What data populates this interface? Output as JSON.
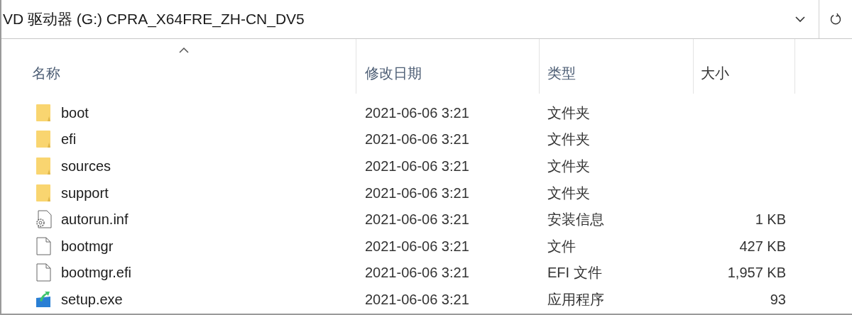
{
  "address_bar": {
    "path": "VD 驱动器 (G:) CPRA_X64FRE_ZH-CN_DV5"
  },
  "columns": [
    {
      "label": "名称",
      "sorted": true
    },
    {
      "label": "修改日期",
      "sorted": false
    },
    {
      "label": "类型",
      "sorted": false
    },
    {
      "label": "大小",
      "sorted": false
    }
  ],
  "rows": [
    {
      "kind": "folder",
      "name": "boot",
      "modified": "2021-06-06 3:21",
      "type": "文件夹"
    },
    {
      "kind": "folder",
      "name": "efi",
      "modified": "2021-06-06 3:21",
      "type": "文件夹"
    },
    {
      "kind": "folder",
      "name": "sources",
      "modified": "2021-06-06 3:21",
      "type": "文件夹"
    },
    {
      "kind": "folder",
      "name": "support",
      "modified": "2021-06-06 3:21",
      "type": "文件夹"
    },
    {
      "kind": "settings",
      "name": "autorun.inf",
      "modified": "2021-06-06 3:21",
      "type": "安装信息",
      "size": "1 KB"
    },
    {
      "kind": "file",
      "name": "bootmgr",
      "modified": "2021-06-06 3:21",
      "type": "文件",
      "size": "427 KB"
    },
    {
      "kind": "file",
      "name": "bootmgr.efi",
      "modified": "2021-06-06 3:21",
      "type": "EFI 文件",
      "size": "1,957 KB"
    },
    {
      "kind": "setup",
      "name": "setup.exe",
      "modified": "2021-06-06 3:21",
      "type": "应用程序",
      "size": "93"
    }
  ]
}
